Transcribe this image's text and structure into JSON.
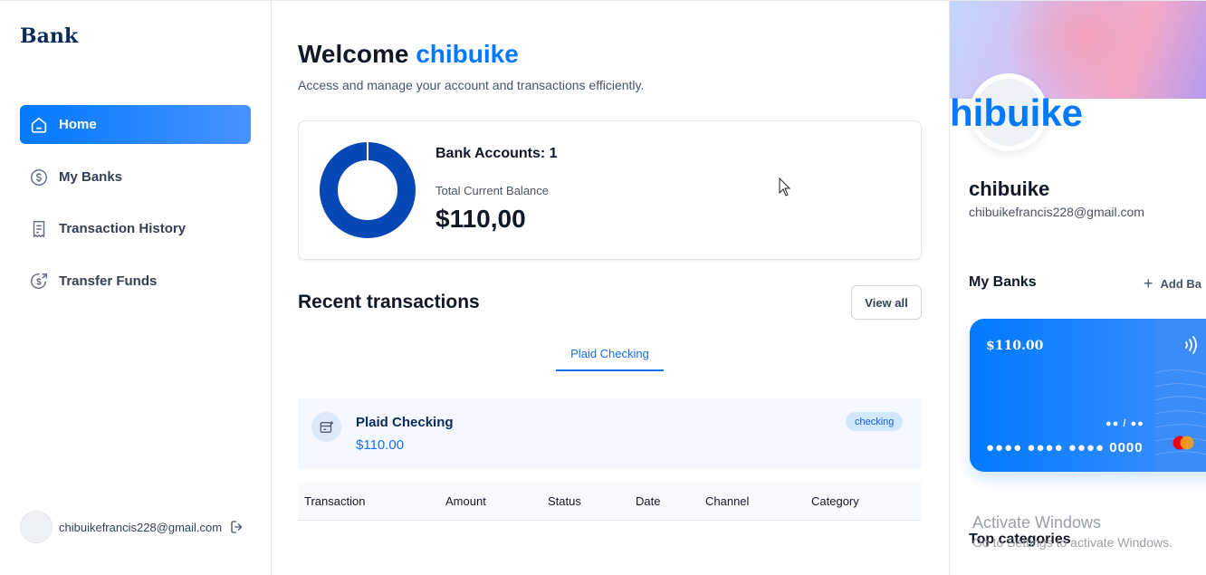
{
  "sidebar": {
    "logo": "Bank",
    "items": [
      {
        "label": "Home",
        "icon": "home-icon",
        "active": true
      },
      {
        "label": "My Banks",
        "icon": "dollar-circle-icon",
        "active": false
      },
      {
        "label": "Transaction History",
        "icon": "receipt-icon",
        "active": false
      },
      {
        "label": "Transfer Funds",
        "icon": "money-send-icon",
        "active": false
      }
    ],
    "footer": {
      "email": "chibuikefrancis228@gmail.com",
      "logout_icon": "logout-icon"
    }
  },
  "header": {
    "welcome_prefix": "Welcome",
    "user_name": "chibuike",
    "subtitle": "Access and manage your account and transactions efficiently."
  },
  "balance": {
    "bank_accounts_label": "Bank Accounts: 1",
    "total_label": "Total Current Balance",
    "total_value": "$110,00",
    "donut_color": "#0747b6"
  },
  "recent": {
    "title": "Recent transactions",
    "view_all": "View all",
    "tabs": [
      {
        "label": "Plaid Checking",
        "active": true
      }
    ],
    "account": {
      "name": "Plaid Checking",
      "balance": "$110.00",
      "badge": "checking"
    },
    "columns": [
      "Transaction",
      "Amount",
      "Status",
      "Date",
      "Channel",
      "Category"
    ]
  },
  "right_panel": {
    "overflow_name": "hibuike",
    "name": "chibuike",
    "email": "chibuikefrancis228@gmail.com",
    "my_banks_title": "My Banks",
    "add_bank": "Add Ba",
    "card": {
      "amount": "$110.00",
      "expiry": "●● / ●●",
      "number": "●●●● ●●●● ●●●● 0000"
    },
    "top_categories": "Top categories"
  },
  "os_overlay": {
    "line1": "Activate Windows",
    "line2": "Go to Settings to activate Windows."
  },
  "colors": {
    "accent": "#0179fe",
    "brand_dark": "#0b2a5b",
    "tab_active": "#1570ef"
  }
}
